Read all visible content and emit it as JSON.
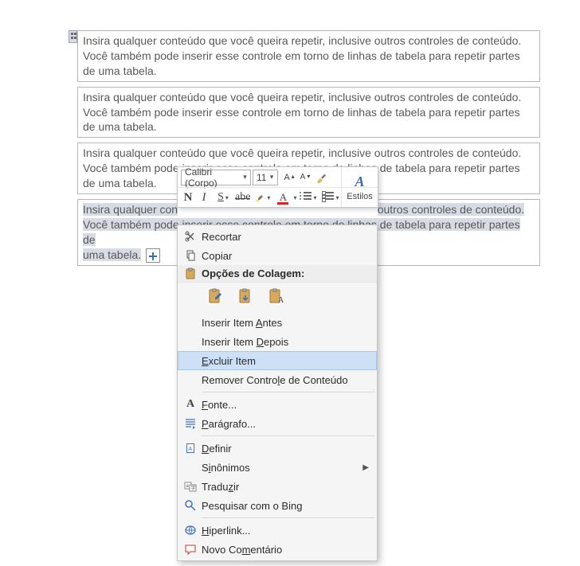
{
  "doc": {
    "placeholder_text": "Insira qualquer conteúdo que você queira repetir, inclusive outros controles de conteúdo. Você também pode inserir esse controle em torno de linhas de tabela para repetir partes de uma tabela.",
    "selected_prefix": "Insira qualquer con",
    "selected_mid1": "outros controles de conteúdo.",
    "selected_line2_a": "Você também pode inserir esse controle em torno de linhas de tabela para repetir partes de",
    "selected_line3": "uma tabela."
  },
  "mini_toolbar": {
    "font_name": "Calibri (Corpo)",
    "font_size": "11",
    "bold": "N",
    "italic": "I",
    "underline": "S",
    "strike": "abe",
    "font_color_letter": "A",
    "styles_label": "Estilos"
  },
  "context_menu": {
    "cut": "Recortar",
    "copy": "Copiar",
    "paste_options_header": "Opções de Colagem:",
    "insert_before_pre": "Inserir Item ",
    "insert_before_u": "A",
    "insert_before_post": "ntes",
    "insert_after_pre": "Inserir Item ",
    "insert_after_u": "D",
    "insert_after_post": "epois",
    "delete_item_u": "E",
    "delete_item_post": "xcluir Item",
    "remove_cc_pre": "Remover Contro",
    "remove_cc_u": "l",
    "remove_cc_post": "e de Conteúdo",
    "font_u": "F",
    "font_post": "onte...",
    "paragraph_u": "P",
    "paragraph_post": "arágrafo...",
    "define_u": "D",
    "define_post": "efinir",
    "synonyms_pre": "S",
    "synonyms_u": "i",
    "synonyms_post": "nônimos",
    "translate_pre": "Tradu",
    "translate_u": "z",
    "translate_post": "ir",
    "search_bing": "Pesquisar com o Bing",
    "hyperlink_u": "H",
    "hyperlink_post": "iperlink...",
    "new_comment_pre": "Novo Co",
    "new_comment_u": "m",
    "new_comment_post": "entário"
  }
}
